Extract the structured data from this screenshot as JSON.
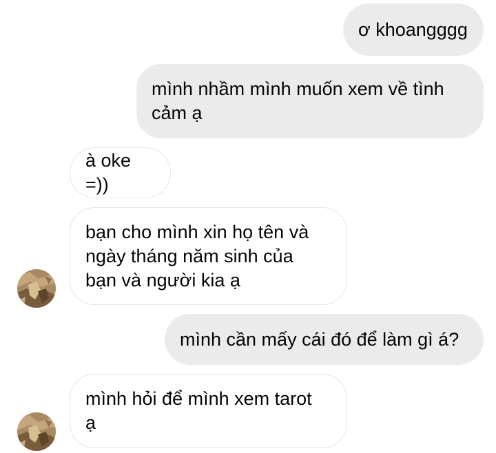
{
  "messages": [
    {
      "id": 1,
      "side": "sent",
      "text": "ơ khoangggg"
    },
    {
      "id": 2,
      "side": "sent",
      "text": "mình nhầm mình muốn xem về tình\ncảm ạ"
    },
    {
      "id": 3,
      "side": "received",
      "text": "à oke =))"
    },
    {
      "id": 4,
      "side": "received",
      "text": "bạn cho mình xin họ tên và\nngày tháng năm sinh của\nbạn và người kia ạ"
    },
    {
      "id": 5,
      "side": "sent",
      "text": "mình cần mấy cái đó để làm gì á?"
    },
    {
      "id": 6,
      "side": "received",
      "text": "mình hỏi để mình xem tarot\nạ"
    }
  ],
  "colors": {
    "sent_bubble": "#ebebeb",
    "received_bubble": "#ffffff",
    "received_border": "#e5e5e5",
    "text": "#050505"
  },
  "icons": {
    "avatar": "contact-avatar-photo"
  }
}
